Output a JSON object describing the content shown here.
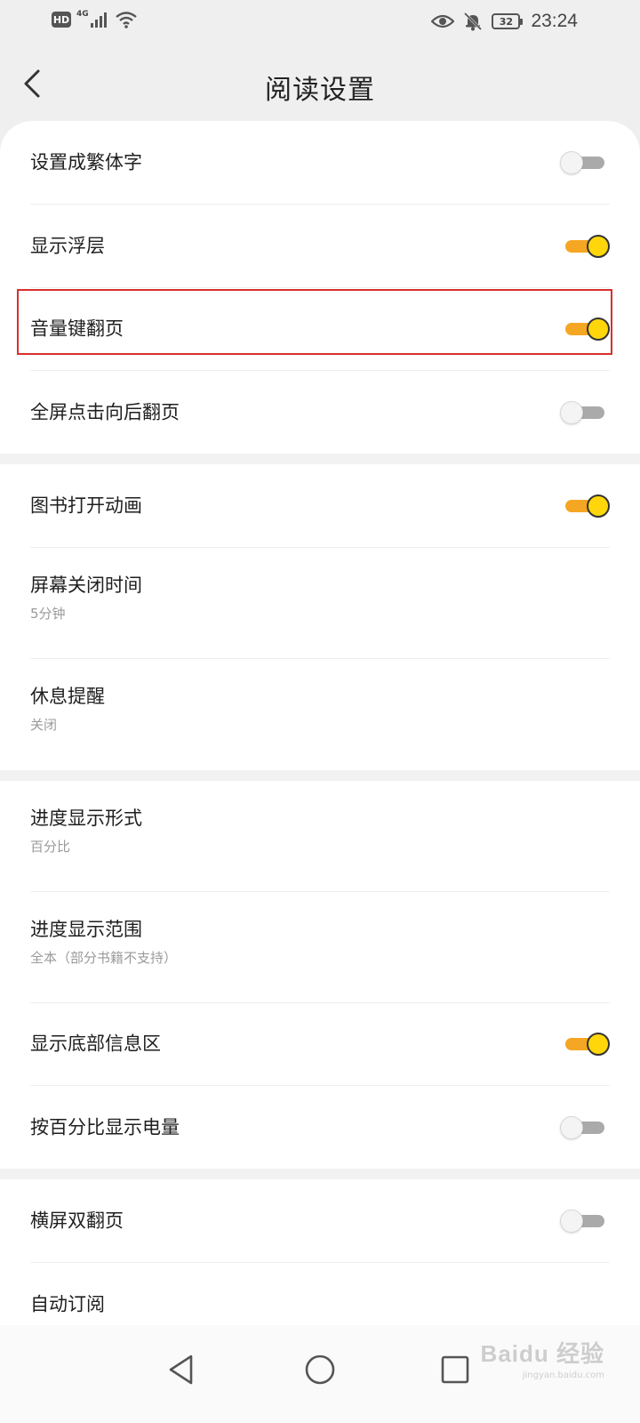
{
  "status_bar": {
    "hd_label": "HD",
    "network_type": "4G",
    "signal_icon": "signal-bars-icon",
    "wifi_icon": "wifi-icon",
    "eye_icon": "eye-icon",
    "mute_icon": "bell-off-icon",
    "battery_level": "32",
    "time": "23:24"
  },
  "header": {
    "title": "阅读设置",
    "back_icon": "chevron-left-icon"
  },
  "settings": {
    "traditional_chinese": {
      "label": "设置成繁体字",
      "enabled": false
    },
    "show_overlay": {
      "label": "显示浮层",
      "enabled": true
    },
    "volume_key_page": {
      "label": "音量键翻页",
      "enabled": true
    },
    "fullscreen_tap": {
      "label": "全屏点击向后翻页",
      "enabled": false
    },
    "book_open_anim": {
      "label": "图书打开动画",
      "enabled": true
    },
    "screen_off_time": {
      "label": "屏幕关闭时间",
      "value": "5分钟"
    },
    "rest_reminder": {
      "label": "休息提醒",
      "value": "关闭"
    },
    "progress_format": {
      "label": "进度显示形式",
      "value": "百分比"
    },
    "progress_range": {
      "label": "进度显示范围",
      "value": "全本（部分书籍不支持）"
    },
    "show_bottom_info": {
      "label": "显示底部信息区",
      "enabled": true
    },
    "battery_percent": {
      "label": "按百分比显示电量",
      "enabled": false
    },
    "landscape_double": {
      "label": "横屏双翻页",
      "enabled": false
    },
    "auto_subscribe": {
      "label": "自动订阅"
    }
  },
  "nav_bar": {
    "back_icon": "triangle-back-icon",
    "home_icon": "circle-home-icon",
    "recents_icon": "square-recents-icon"
  },
  "watermark": {
    "logo": "Baidu 经验",
    "url": "jingyan.baidu.com"
  },
  "colors": {
    "toggle_on_track": "#f5a623",
    "toggle_on_knob": "#ffd60a",
    "toggle_off_track": "#aaaaaa",
    "highlight_border": "#d9302c"
  }
}
